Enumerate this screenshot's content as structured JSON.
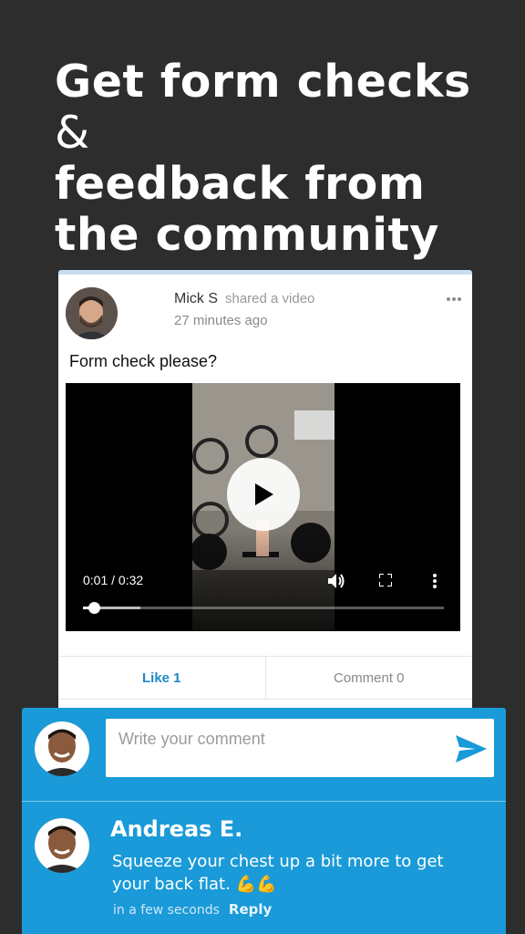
{
  "hero": {
    "line1": "Get form checks",
    "amp": "&",
    "line2": "feedback from",
    "line3": "the community"
  },
  "post": {
    "author": "Mick S",
    "action": "shared a video",
    "time": "27 minutes ago",
    "text": "Form check please?",
    "video": {
      "current_time": "0:01",
      "duration": "0:32",
      "progress_fraction": 0.03,
      "buffered_fraction": 0.16
    },
    "like_label": "Like 1",
    "comment_label": "Comment 0"
  },
  "composer": {
    "placeholder": "Write your comment"
  },
  "comment": {
    "author": "Andreas E.",
    "text": "Squeeze your chest up a bit more to get your back flat.",
    "emoji": "💪💪",
    "time": "in a few seconds",
    "reply_label": "Reply"
  },
  "colors": {
    "background": "#2d2d2d",
    "accent": "#1a9ad8",
    "like": "#1e88c8"
  }
}
